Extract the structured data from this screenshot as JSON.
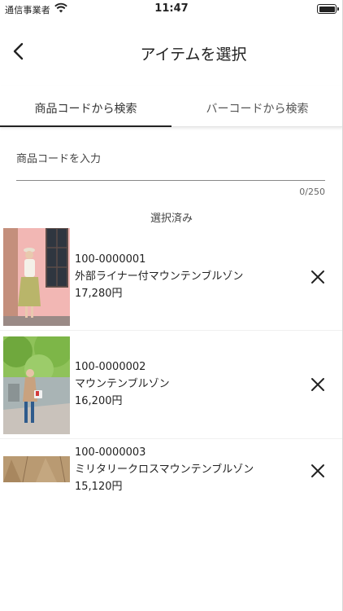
{
  "status_bar": {
    "carrier": "通信事業者",
    "time": "11:47"
  },
  "header": {
    "title": "アイテムを選択"
  },
  "tabs": [
    {
      "label": "商品コードから検索",
      "active": true
    },
    {
      "label": "バーコードから検索",
      "active": false
    }
  ],
  "search": {
    "placeholder": "商品コードを入力",
    "value": "",
    "counter": "0/250"
  },
  "selected": {
    "section_label": "選択済み",
    "items": [
      {
        "code": "100-0000001",
        "name": "外部ライナー付マウンテンブルゾン",
        "price": "17,280円"
      },
      {
        "code": "100-0000002",
        "name": "マウンテンブルゾン",
        "price": "16,200円"
      },
      {
        "code": "100-0000003",
        "name": "ミリタリークロスマウンテンブルゾン",
        "price": "15,120円"
      }
    ]
  },
  "colors": {
    "text": "#222222",
    "divider": "#e3e3e3",
    "active_tab_indicator": "#222222"
  }
}
